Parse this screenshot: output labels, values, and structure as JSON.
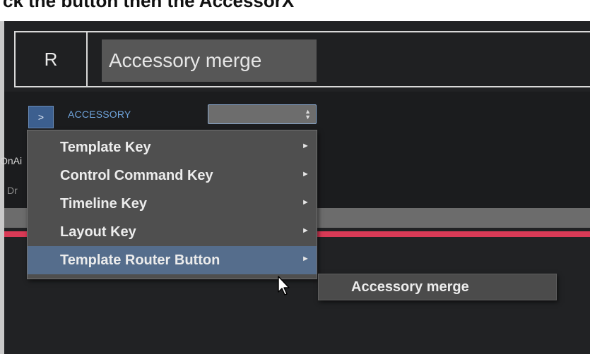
{
  "caption": {
    "text": "ck the button then the AccessorX"
  },
  "header": {
    "r_label": "R",
    "name_value": "Accessory merge"
  },
  "accessory": {
    "expand_label": ">",
    "label": "ACCESSORY",
    "select_value": ""
  },
  "background_text": {
    "onair": "OnAi",
    "dr": "Dr"
  },
  "context_menu": {
    "items": [
      {
        "label": "Template Key",
        "has_submenu": true,
        "highlighted": false
      },
      {
        "label": "Control Command Key",
        "has_submenu": true,
        "highlighted": false
      },
      {
        "label": "Timeline Key",
        "has_submenu": true,
        "highlighted": false
      },
      {
        "label": "Layout Key",
        "has_submenu": true,
        "highlighted": false
      },
      {
        "label": "Template Router Button",
        "has_submenu": true,
        "highlighted": true
      }
    ],
    "submenu": {
      "items": [
        {
          "label": "Accessory merge"
        }
      ]
    }
  },
  "colors": {
    "background": "#212224",
    "menu_bg": "#4f4f4f",
    "menu_highlight": "#556d8c",
    "accent_blue": "#6fa4dc",
    "red_strip": "#d93a56"
  },
  "icons": {
    "submenu_arrow": "triangle-right",
    "select_arrows": "up-down-arrows",
    "cursor": "mouse-pointer"
  }
}
